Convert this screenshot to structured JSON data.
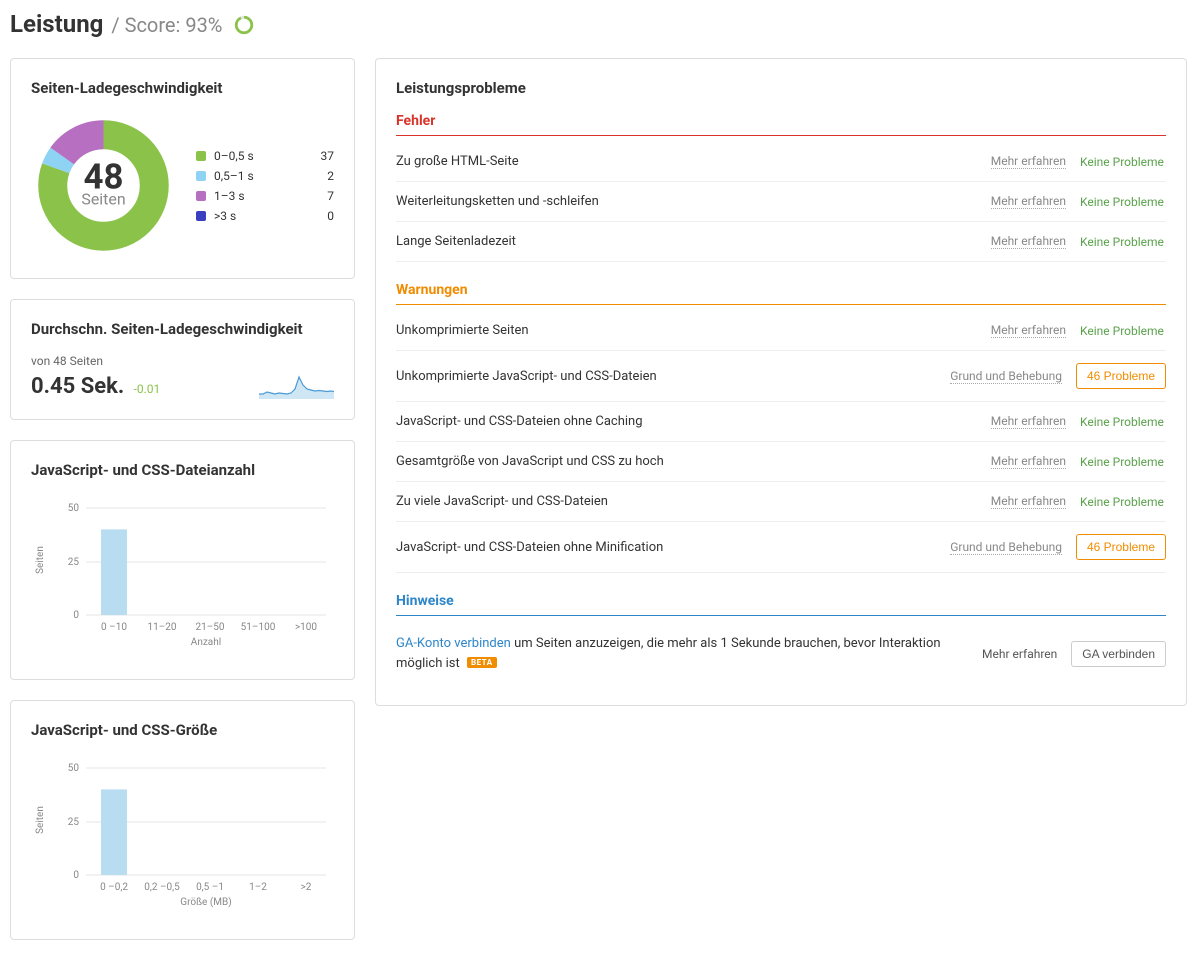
{
  "header": {
    "title": "Leistung",
    "score_label": "/ Score: 93%",
    "score_pct": 93
  },
  "donut_card": {
    "title": "Seiten-Ladegeschwindigkeit",
    "center_value": "48",
    "center_label": "Seiten",
    "legend": [
      {
        "label": "0–0,5 s",
        "value": "37",
        "color": "#8bc34a"
      },
      {
        "label": "0,5–1 s",
        "value": "2",
        "color": "#8fd3f4"
      },
      {
        "label": "1–3 s",
        "value": "7",
        "color": "#b76fc1"
      },
      {
        "label": ">3 s",
        "value": "0",
        "color": "#3a3fbd"
      }
    ]
  },
  "avg_card": {
    "title": "Durchschn. Seiten-Ladegeschwindigkeit",
    "subtitle": "von 48 Seiten",
    "value": "0.45 Sek.",
    "delta": "-0.01"
  },
  "barchart1": {
    "title": "JavaScript- und CSS-Dateianzahl",
    "ylabel": "Seiten",
    "xlabel": "Anzahl",
    "yticks": [
      "0",
      "25",
      "50"
    ],
    "categories": [
      "0 –10",
      "11–20",
      "21–50",
      "51–100",
      ">100"
    ]
  },
  "barchart2": {
    "title": "JavaScript- und CSS-Größe",
    "ylabel": "Seiten",
    "xlabel": "Größe (MB)",
    "yticks": [
      "0",
      "25",
      "50"
    ],
    "categories": [
      "0 –0,2",
      "0,2 –0,5",
      "0,5 –1",
      "1–2",
      ">2"
    ]
  },
  "issues_card": {
    "title": "Leistungsprobleme",
    "labels": {
      "errors": "Fehler",
      "warnings": "Warnungen",
      "notes": "Hinweise",
      "more": "Mehr erfahren",
      "reason": "Grund und Behebung",
      "ok": "Keine Probleme",
      "ga_connect_link": "GA-Konto verbinden",
      "ga_text": " um Seiten anzuzeigen, die mehr als 1 Sekunde brauchen, bevor Interaktion möglich ist ",
      "beta": "BETA",
      "ga_button": "GA verbinden"
    },
    "errors": [
      {
        "name": "Zu große HTML-Seite",
        "more": "more",
        "status": "ok"
      },
      {
        "name": "Weiterleitungsketten und -schleifen",
        "more": "more",
        "status": "ok"
      },
      {
        "name": "Lange Seitenladezeit",
        "more": "more",
        "status": "ok"
      }
    ],
    "warnings": [
      {
        "name": "Unkomprimierte Seiten",
        "more": "more",
        "status": "ok"
      },
      {
        "name": "Unkomprimierte JavaScript- und CSS-Dateien",
        "more": "reason",
        "status": "46 Probleme"
      },
      {
        "name": "JavaScript- und CSS-Dateien ohne Caching",
        "more": "more",
        "status": "ok"
      },
      {
        "name": "Gesamtgröße von JavaScript und CSS zu hoch",
        "more": "more",
        "status": "ok"
      },
      {
        "name": "Zu viele JavaScript- und CSS-Dateien",
        "more": "more",
        "status": "ok"
      },
      {
        "name": "JavaScript- und CSS-Dateien ohne Minification",
        "more": "reason",
        "status": "46 Probleme"
      }
    ]
  },
  "chart_data": [
    {
      "type": "pie",
      "title": "Seiten-Ladegeschwindigkeit",
      "categories": [
        "0–0,5 s",
        "0,5–1 s",
        "1–3 s",
        ">3 s"
      ],
      "values": [
        37,
        2,
        7,
        0
      ],
      "total": 48
    },
    {
      "type": "line",
      "title": "Durchschn. Seiten-Ladegeschwindigkeit (sparkline)",
      "x": [
        0,
        1,
        2,
        3,
        4,
        5,
        6,
        7,
        8,
        9,
        10,
        11,
        12,
        13,
        14,
        15,
        16,
        17,
        18,
        19
      ],
      "values": [
        0.4,
        0.4,
        0.44,
        0.42,
        0.4,
        0.42,
        0.41,
        0.4,
        0.42,
        0.5,
        0.85,
        0.58,
        0.5,
        0.48,
        0.46,
        0.47,
        0.46,
        0.45,
        0.46,
        0.45
      ],
      "ylabel": "Sek."
    },
    {
      "type": "bar",
      "title": "JavaScript- und CSS-Dateianzahl",
      "categories": [
        "0 –10",
        "11–20",
        "21–50",
        "51–100",
        ">100"
      ],
      "values": [
        40,
        0,
        0,
        0,
        0
      ],
      "xlabel": "Anzahl",
      "ylabel": "Seiten",
      "ylim": [
        0,
        50
      ]
    },
    {
      "type": "bar",
      "title": "JavaScript- und CSS-Größe",
      "categories": [
        "0 –0,2",
        "0,2 –0,5",
        "0,5 –1",
        "1–2",
        ">2"
      ],
      "values": [
        40,
        0,
        0,
        0,
        0
      ],
      "xlabel": "Größe (MB)",
      "ylabel": "Seiten",
      "ylim": [
        0,
        50
      ]
    }
  ]
}
